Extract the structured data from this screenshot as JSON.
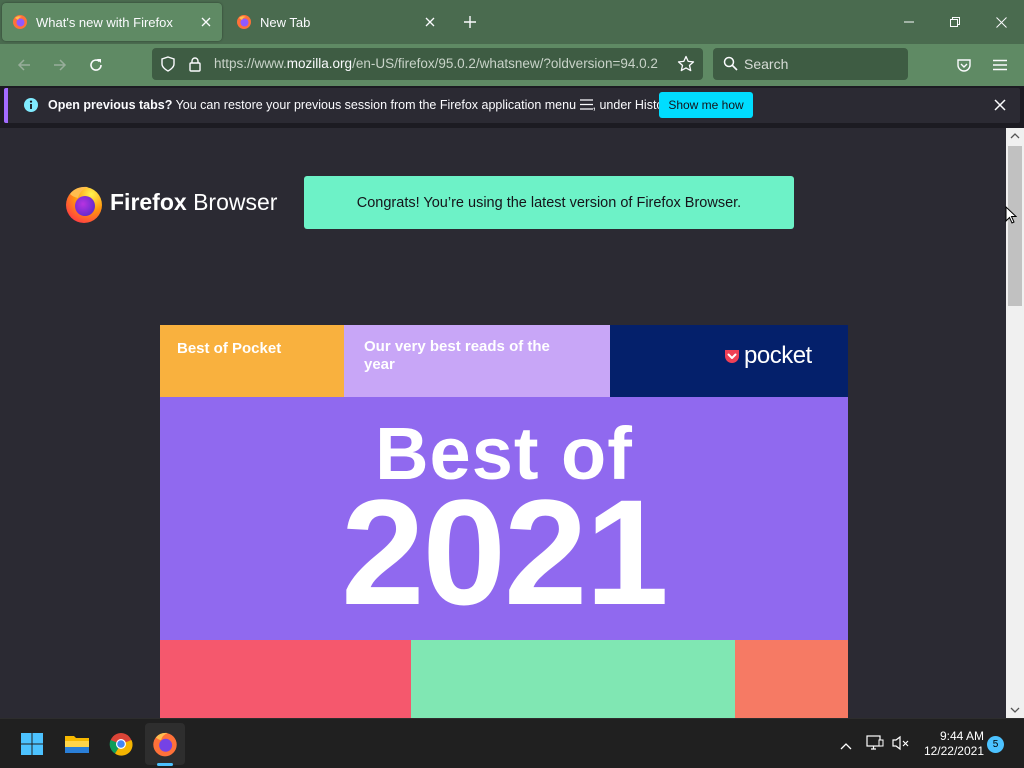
{
  "tabs": [
    {
      "title": "What's new with Firefox",
      "active": true,
      "icon": "firefox-icon"
    },
    {
      "title": "New Tab",
      "active": false,
      "icon": "firefox-icon"
    }
  ],
  "navbar": {
    "url_prefix": "https://www.",
    "url_host": "mozilla.org",
    "url_path": "/en-US/firefox/95.0.2/whatsnew/?oldversion=94.0.2",
    "search_placeholder": "Search"
  },
  "notification": {
    "bold": "Open previous tabs?",
    "text_before_icon": " You can restore your previous session from the Firefox application menu ",
    "text_after_icon": ", under History.",
    "button": "Show me how"
  },
  "page": {
    "brand_bold": "Firefox",
    "brand_regular": " Browser",
    "congrats": "Congrats! You’re using the latest version of Firefox Browser."
  },
  "pocket_card": {
    "tag": "Best of Pocket",
    "tagline": "Our very best reads of the year",
    "brand": "pocket",
    "headline": "Best of",
    "year": "2021"
  },
  "taskbar": {
    "time": "9:44 AM",
    "date": "12/22/2021",
    "notification_count": "5"
  },
  "colors": {
    "accent": "#00ddff",
    "congrats_bg": "#6df2c7",
    "pocket_purple": "#9069ef",
    "pocket_navy": "#04206b",
    "toolbar_green": "#5f8a64"
  }
}
